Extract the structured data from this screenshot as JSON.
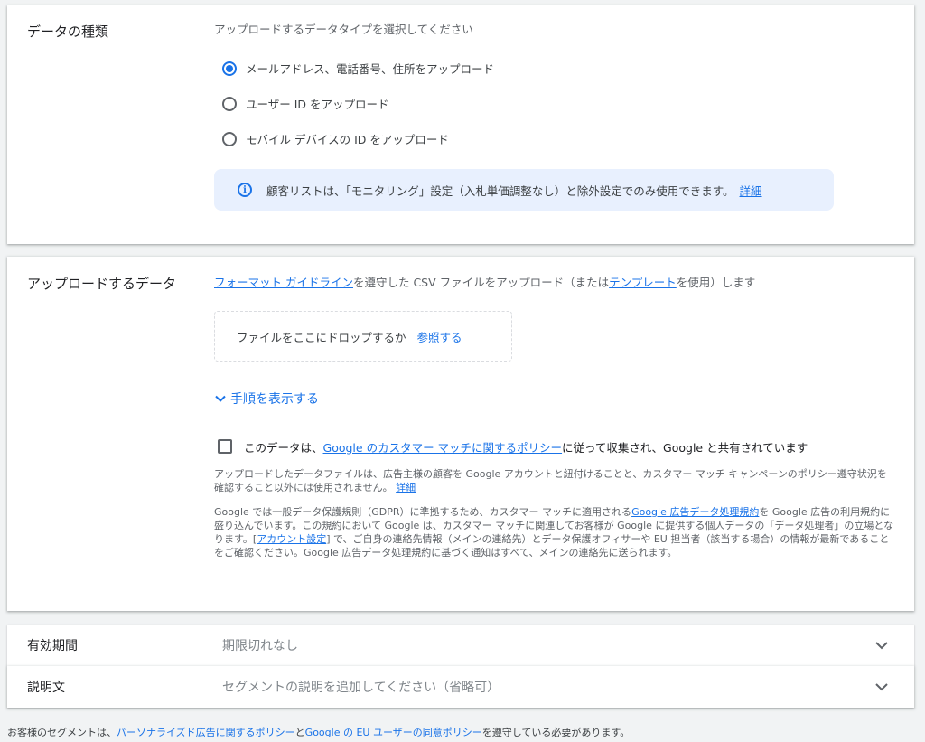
{
  "data_type": {
    "title": "データの種類",
    "subtitle": "アップロードするデータタイプを選択してください",
    "options": [
      {
        "label": "メールアドレス、電話番号、住所をアップロード",
        "selected": true
      },
      {
        "label": "ユーザー ID をアップロード",
        "selected": false
      },
      {
        "label": "モバイル デバイスの ID をアップロード",
        "selected": false
      }
    ],
    "info_icon": "info-icon",
    "info_text": "顧客リストは、「モニタリング」設定（入札単価調整なし）と除外設定でのみ使用できます。",
    "info_link": "詳細"
  },
  "upload": {
    "title": "アップロードするデータ",
    "intro_link1": "フォーマット ガイドライン",
    "intro_text1": "を遵守した CSV ファイルをアップロード（または",
    "intro_link2": "テンプレート",
    "intro_text2": "を使用）します",
    "drop_text": "ファイルをここにドロップするか",
    "browse_link": "参照する",
    "expand_icon": "chevron-down-icon",
    "expand_label": "手順を表示する",
    "consent_checked": false,
    "consent_text1": "このデータは、",
    "consent_link": "Google のカスタマー マッチに関するポリシー",
    "consent_text2": "に従って収集され、Google と共有されています",
    "para1_text": "アップロードしたデータファイルは、広告主様の顧客を Google アカウントと紐付けることと、カスタマー マッチ キャンペーンのポリシー遵守状況を確認すること以外には使用されません。",
    "para1_link": "詳細",
    "para2_text1": "Google では一般データ保護規則（GDPR）に準拠するため、カスタマー マッチに適用される",
    "para2_link1": "Google 広告データ処理規約",
    "para2_text2": "を Google 広告の利用規約に盛り込んでいます。この規約において Google は、カスタマー マッチに関連してお客様が Google に提供する個人データの「データ処理者」の立場となります。[",
    "para2_link2": "アカウント設定",
    "para2_text3": "] で、ご自身の連絡先情報（メインの連絡先）とデータ保護オフィサーや EU 担当者（該当する場合）の情報が最新であることをご確認ください。Google 広告データ処理規約に基づく通知はすべて、メインの連絡先に送られます。"
  },
  "expiration": {
    "label": "有効期間",
    "value": "期限切れなし"
  },
  "description": {
    "label": "説明文",
    "placeholder": "セグメントの説明を追加してください（省略可）"
  },
  "footer": {
    "text1": "お客様のセグメントは、",
    "link1": "パーソナライズド広告に関するポリシー",
    "text2": "と",
    "link2": "Google の EU ユーザーの同意ポリシー",
    "text3": "を遵守している必要があります。"
  },
  "colors": {
    "accent": "#1a73e8",
    "info_bg": "#e8f0fe",
    "page_bg": "#f1f3f4"
  }
}
